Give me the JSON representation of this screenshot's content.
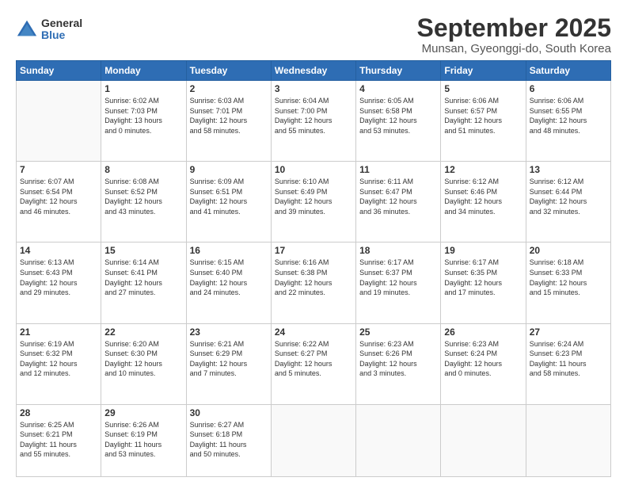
{
  "header": {
    "logo_general": "General",
    "logo_blue": "Blue",
    "month_title": "September 2025",
    "location": "Munsan, Gyeonggi-do, South Korea"
  },
  "days_of_week": [
    "Sunday",
    "Monday",
    "Tuesday",
    "Wednesday",
    "Thursday",
    "Friday",
    "Saturday"
  ],
  "weeks": [
    [
      {
        "day": "",
        "info": ""
      },
      {
        "day": "1",
        "info": "Sunrise: 6:02 AM\nSunset: 7:03 PM\nDaylight: 13 hours\nand 0 minutes."
      },
      {
        "day": "2",
        "info": "Sunrise: 6:03 AM\nSunset: 7:01 PM\nDaylight: 12 hours\nand 58 minutes."
      },
      {
        "day": "3",
        "info": "Sunrise: 6:04 AM\nSunset: 7:00 PM\nDaylight: 12 hours\nand 55 minutes."
      },
      {
        "day": "4",
        "info": "Sunrise: 6:05 AM\nSunset: 6:58 PM\nDaylight: 12 hours\nand 53 minutes."
      },
      {
        "day": "5",
        "info": "Sunrise: 6:06 AM\nSunset: 6:57 PM\nDaylight: 12 hours\nand 51 minutes."
      },
      {
        "day": "6",
        "info": "Sunrise: 6:06 AM\nSunset: 6:55 PM\nDaylight: 12 hours\nand 48 minutes."
      }
    ],
    [
      {
        "day": "7",
        "info": "Sunrise: 6:07 AM\nSunset: 6:54 PM\nDaylight: 12 hours\nand 46 minutes."
      },
      {
        "day": "8",
        "info": "Sunrise: 6:08 AM\nSunset: 6:52 PM\nDaylight: 12 hours\nand 43 minutes."
      },
      {
        "day": "9",
        "info": "Sunrise: 6:09 AM\nSunset: 6:51 PM\nDaylight: 12 hours\nand 41 minutes."
      },
      {
        "day": "10",
        "info": "Sunrise: 6:10 AM\nSunset: 6:49 PM\nDaylight: 12 hours\nand 39 minutes."
      },
      {
        "day": "11",
        "info": "Sunrise: 6:11 AM\nSunset: 6:47 PM\nDaylight: 12 hours\nand 36 minutes."
      },
      {
        "day": "12",
        "info": "Sunrise: 6:12 AM\nSunset: 6:46 PM\nDaylight: 12 hours\nand 34 minutes."
      },
      {
        "day": "13",
        "info": "Sunrise: 6:12 AM\nSunset: 6:44 PM\nDaylight: 12 hours\nand 32 minutes."
      }
    ],
    [
      {
        "day": "14",
        "info": "Sunrise: 6:13 AM\nSunset: 6:43 PM\nDaylight: 12 hours\nand 29 minutes."
      },
      {
        "day": "15",
        "info": "Sunrise: 6:14 AM\nSunset: 6:41 PM\nDaylight: 12 hours\nand 27 minutes."
      },
      {
        "day": "16",
        "info": "Sunrise: 6:15 AM\nSunset: 6:40 PM\nDaylight: 12 hours\nand 24 minutes."
      },
      {
        "day": "17",
        "info": "Sunrise: 6:16 AM\nSunset: 6:38 PM\nDaylight: 12 hours\nand 22 minutes."
      },
      {
        "day": "18",
        "info": "Sunrise: 6:17 AM\nSunset: 6:37 PM\nDaylight: 12 hours\nand 19 minutes."
      },
      {
        "day": "19",
        "info": "Sunrise: 6:17 AM\nSunset: 6:35 PM\nDaylight: 12 hours\nand 17 minutes."
      },
      {
        "day": "20",
        "info": "Sunrise: 6:18 AM\nSunset: 6:33 PM\nDaylight: 12 hours\nand 15 minutes."
      }
    ],
    [
      {
        "day": "21",
        "info": "Sunrise: 6:19 AM\nSunset: 6:32 PM\nDaylight: 12 hours\nand 12 minutes."
      },
      {
        "day": "22",
        "info": "Sunrise: 6:20 AM\nSunset: 6:30 PM\nDaylight: 12 hours\nand 10 minutes."
      },
      {
        "day": "23",
        "info": "Sunrise: 6:21 AM\nSunset: 6:29 PM\nDaylight: 12 hours\nand 7 minutes."
      },
      {
        "day": "24",
        "info": "Sunrise: 6:22 AM\nSunset: 6:27 PM\nDaylight: 12 hours\nand 5 minutes."
      },
      {
        "day": "25",
        "info": "Sunrise: 6:23 AM\nSunset: 6:26 PM\nDaylight: 12 hours\nand 3 minutes."
      },
      {
        "day": "26",
        "info": "Sunrise: 6:23 AM\nSunset: 6:24 PM\nDaylight: 12 hours\nand 0 minutes."
      },
      {
        "day": "27",
        "info": "Sunrise: 6:24 AM\nSunset: 6:23 PM\nDaylight: 11 hours\nand 58 minutes."
      }
    ],
    [
      {
        "day": "28",
        "info": "Sunrise: 6:25 AM\nSunset: 6:21 PM\nDaylight: 11 hours\nand 55 minutes."
      },
      {
        "day": "29",
        "info": "Sunrise: 6:26 AM\nSunset: 6:19 PM\nDaylight: 11 hours\nand 53 minutes."
      },
      {
        "day": "30",
        "info": "Sunrise: 6:27 AM\nSunset: 6:18 PM\nDaylight: 11 hours\nand 50 minutes."
      },
      {
        "day": "",
        "info": ""
      },
      {
        "day": "",
        "info": ""
      },
      {
        "day": "",
        "info": ""
      },
      {
        "day": "",
        "info": ""
      }
    ]
  ]
}
